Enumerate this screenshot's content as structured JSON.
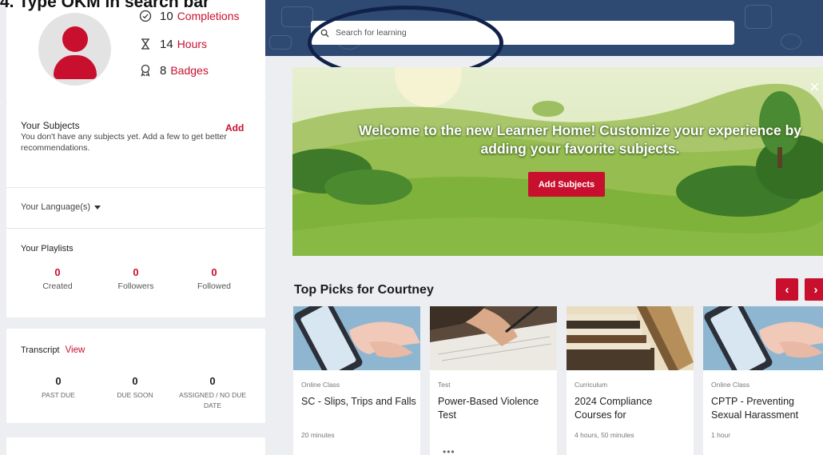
{
  "instruction": "4. Type OKM in search bar",
  "profile": {
    "completions": {
      "value": "10",
      "label": "Completions"
    },
    "hours": {
      "value": "14",
      "label": "Hours"
    },
    "badges": {
      "value": "8",
      "label": "Badges"
    }
  },
  "subjects": {
    "title": "Your Subjects",
    "add_label": "Add",
    "empty_text": "You don't have any subjects yet. Add a few to get better recommendations."
  },
  "language": {
    "label": "Your Language(s)"
  },
  "playlists": {
    "title": "Your Playlists",
    "stats": [
      {
        "value": "0",
        "label": "Created"
      },
      {
        "value": "0",
        "label": "Followers"
      },
      {
        "value": "0",
        "label": "Followed"
      }
    ]
  },
  "transcript": {
    "title": "Transcript",
    "view_label": "View",
    "stats": [
      {
        "value": "0",
        "label": "PAST DUE"
      },
      {
        "value": "0",
        "label": "DUE SOON"
      },
      {
        "value": "0",
        "label": "ASSIGNED / NO DUE DATE"
      }
    ]
  },
  "search": {
    "placeholder": "Search for learning"
  },
  "hero": {
    "message": "Welcome to the new Learner Home! Customize your experience by adding your favorite subjects.",
    "button_label": "Add Subjects",
    "close_glyph": "×"
  },
  "top_picks": {
    "title": "Top Picks for Courtney",
    "prev_glyph": "‹",
    "next_glyph": "›",
    "courses": [
      {
        "type": "Online Class",
        "title": "SC - Slips, Trips and Falls",
        "duration": "20 minutes",
        "thumb": "hands-phone"
      },
      {
        "type": "Test",
        "title": "Power-Based Violence Test",
        "duration": "",
        "more": "•••",
        "thumb": "writing"
      },
      {
        "type": "Curriculum",
        "title": "2024 Compliance Courses for",
        "duration": "4 hours, 50 minutes",
        "thumb": "books"
      },
      {
        "type": "Online Class",
        "title": "CPTP - Preventing Sexual Harassment",
        "duration": "1 hour",
        "thumb": "hands-phone"
      }
    ]
  },
  "colors": {
    "accent": "#c8102e",
    "header": "#2f4a72",
    "annotation": "#11224a"
  }
}
